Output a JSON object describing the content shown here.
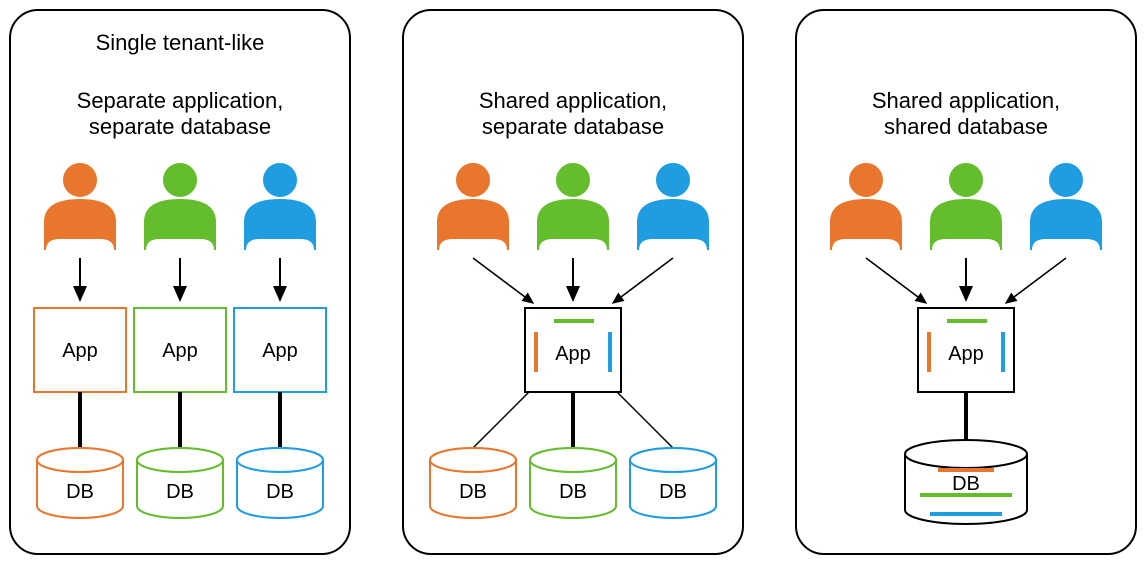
{
  "colors": {
    "orange": "#E8762C",
    "orange_stroke": "#E8762C",
    "green": "#64BD2D",
    "green_stroke": "#64BD2D",
    "blue": "#209DE0",
    "blue_stroke": "#209DE0",
    "panel_stroke": "#000000",
    "line": "#000000"
  },
  "labels": {
    "app": "App",
    "db": "DB"
  },
  "panels": [
    {
      "id": "single",
      "title_line1": "Single tenant-like",
      "title_line2": "Separate application,",
      "title_line3": "separate database",
      "has_top_title": true
    },
    {
      "id": "shared_app",
      "title_line2": "Shared application,",
      "title_line3": "separate database",
      "has_top_title": false
    },
    {
      "id": "shared_all",
      "title_line2": "Shared application,",
      "title_line3": "shared database",
      "has_top_title": false
    }
  ]
}
